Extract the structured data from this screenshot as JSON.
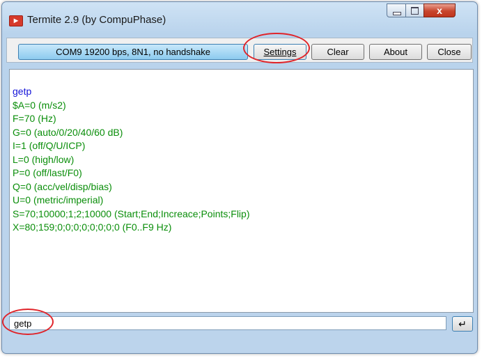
{
  "window": {
    "title": "Termite 2.9 (by CompuPhase)",
    "icon": "termite-app-icon",
    "controls": {
      "close_glyph": "x"
    }
  },
  "toolbar": {
    "port_label": "COM9 19200 bps, 8N1, no handshake",
    "settings_label": "Settings",
    "clear_label": "Clear",
    "about_label": "About",
    "close_label": "Close"
  },
  "output": {
    "lines": [
      {
        "text": "getp",
        "kind": "cmd"
      },
      {
        "text": "$A=0 (m/s2)",
        "kind": "resp"
      },
      {
        "text": "F=70 (Hz)",
        "kind": "resp"
      },
      {
        "text": "G=0 (auto/0/20/40/60 dB)",
        "kind": "resp"
      },
      {
        "text": "I=1 (off/Q/U/ICP)",
        "kind": "resp"
      },
      {
        "text": "L=0 (high/low)",
        "kind": "resp"
      },
      {
        "text": "P=0 (off/last/F0)",
        "kind": "resp"
      },
      {
        "text": "Q=0 (acc/vel/disp/bias)",
        "kind": "resp"
      },
      {
        "text": "U=0 (metric/imperial)",
        "kind": "resp"
      },
      {
        "text": "S=70;10000;1;2;10000 (Start;End;Increace;Points;Flip)",
        "kind": "resp"
      },
      {
        "text": "X=80;159;0;0;0;0;0;0;0;0 (F0..F9 Hz)",
        "kind": "resp"
      }
    ]
  },
  "input": {
    "value": "getp",
    "send_glyph": "↵"
  },
  "colors": {
    "command_text": "#1414d8",
    "response_text": "#0a8e0a",
    "annotation_ring": "#e0242a"
  }
}
